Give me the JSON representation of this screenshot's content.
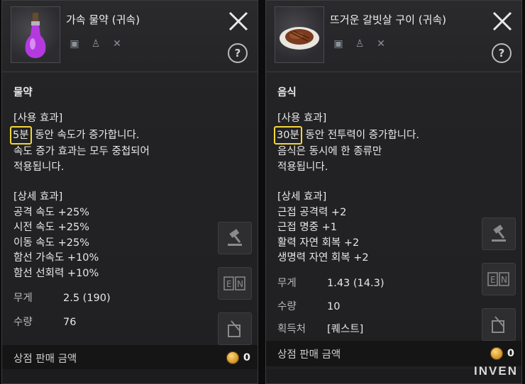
{
  "panels": [
    {
      "title": "가속 물약 (귀속)",
      "thumbnail_icon": "potion-icon",
      "category": "물약",
      "use_effect_header": "[사용 효과]",
      "use_effect_highlight": "5분",
      "use_effect_line1_rest": "동안 속도가 증가합니다.",
      "use_effect_line2": "속도 증가 효과는 모두 중첩되어",
      "use_effect_line3": "적용됩니다.",
      "detail_header": "[상세 효과]",
      "details": [
        "공격 속도 +25%",
        "시전 속도 +25%",
        "이동 속도 +25%",
        "함선 가속도 +10%",
        "함선 선회력 +10%"
      ],
      "weight_label": "무게",
      "weight_value": "2.5 (190)",
      "qty_label": "수량",
      "qty_value": "76",
      "sell_label": "상점 판매 금액",
      "sell_value": "0"
    },
    {
      "title": "뜨거운 갈빗살 구이 (귀속)",
      "thumbnail_icon": "steak-icon",
      "category": "음식",
      "use_effect_header": "[사용 효과]",
      "use_effect_highlight": "30분",
      "use_effect_line1_rest": "동안 전투력이 증가합니다.",
      "use_effect_line2": "음식은 동시에 한 종류만",
      "use_effect_line3": "적용됩니다.",
      "detail_header": "[상세 효과]",
      "details": [
        "근접 공격력 +2",
        "근접 명중 +1",
        "활력 자연 회복 +2",
        "생명력 자연 회복 +2"
      ],
      "weight_label": "무게",
      "weight_value": "1.43 (14.3)",
      "qty_label": "수량",
      "qty_value": "10",
      "extra_label": "획득처",
      "extra_value": "[퀘스트]",
      "sell_label": "상점 판매 금액",
      "sell_value": "0"
    }
  ],
  "watermark": "INVEN",
  "colors": {
    "highlight": "#f2d63c",
    "panel_bg": "#232325"
  }
}
